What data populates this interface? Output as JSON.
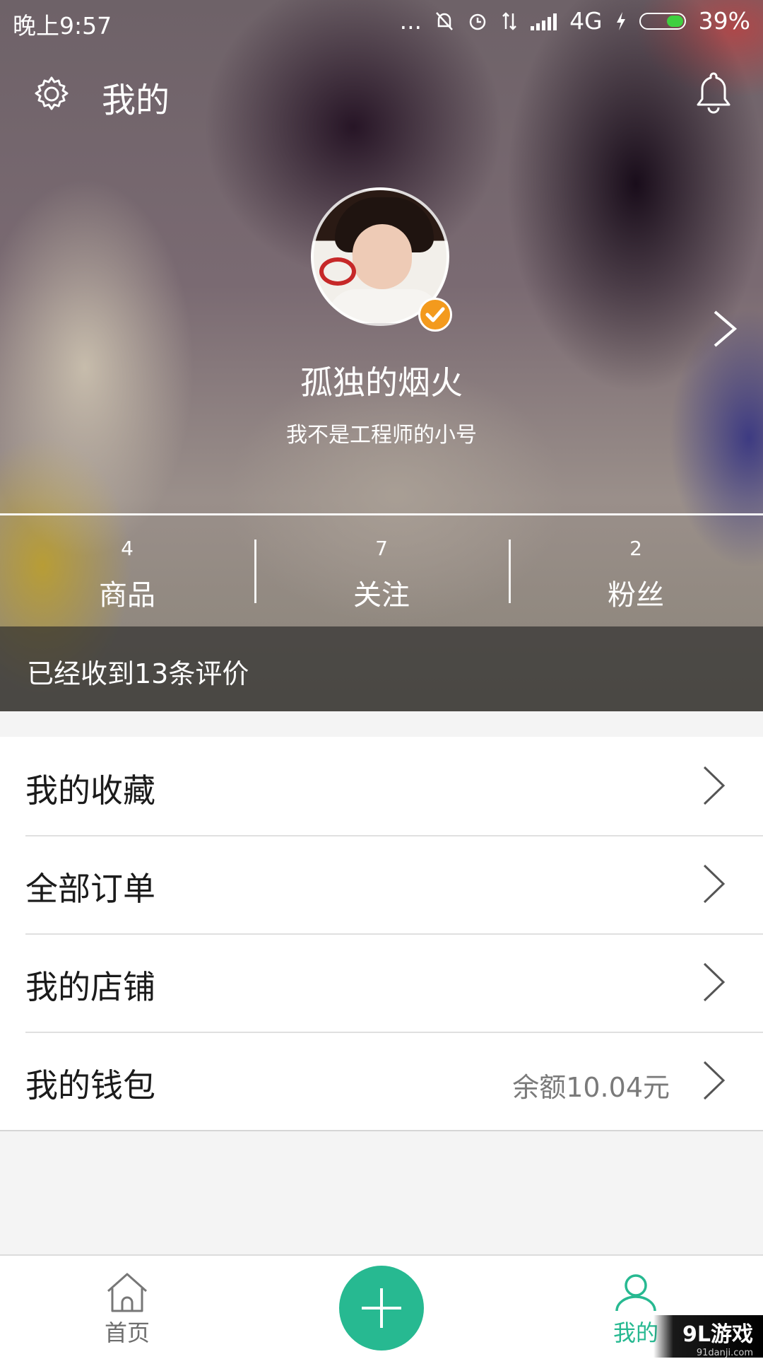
{
  "status_bar": {
    "time": "晚上9:57",
    "dots": "...",
    "network": "4G",
    "battery": "39%",
    "battery_level": 0.39
  },
  "header": {
    "title": "我的"
  },
  "profile": {
    "nickname": "孤独的烟火",
    "bio": "我不是工程师的小号"
  },
  "stats": [
    {
      "value": "4",
      "label": "商品"
    },
    {
      "value": "7",
      "label": "关注"
    },
    {
      "value": "2",
      "label": "粉丝"
    }
  ],
  "reviews_text": "已经收到13条评价",
  "menu": [
    {
      "label": "我的收藏",
      "extra": ""
    },
    {
      "label": "全部订单",
      "extra": ""
    },
    {
      "label": "我的店铺",
      "extra": ""
    },
    {
      "label": "我的钱包",
      "extra": "余额10.04元"
    }
  ],
  "bottom_nav": {
    "home_label": "首页",
    "me_label": "我的"
  },
  "watermark": {
    "title": "9L游戏",
    "url": "91danji.com"
  },
  "colors": {
    "accent": "#27b991",
    "verify_badge": "#f39a1d",
    "battery_fill": "#3fd03f"
  },
  "icons": [
    "gear-icon",
    "bell-icon",
    "chevron-right-icon",
    "home-icon",
    "plus-icon",
    "person-icon",
    "check-icon"
  ]
}
